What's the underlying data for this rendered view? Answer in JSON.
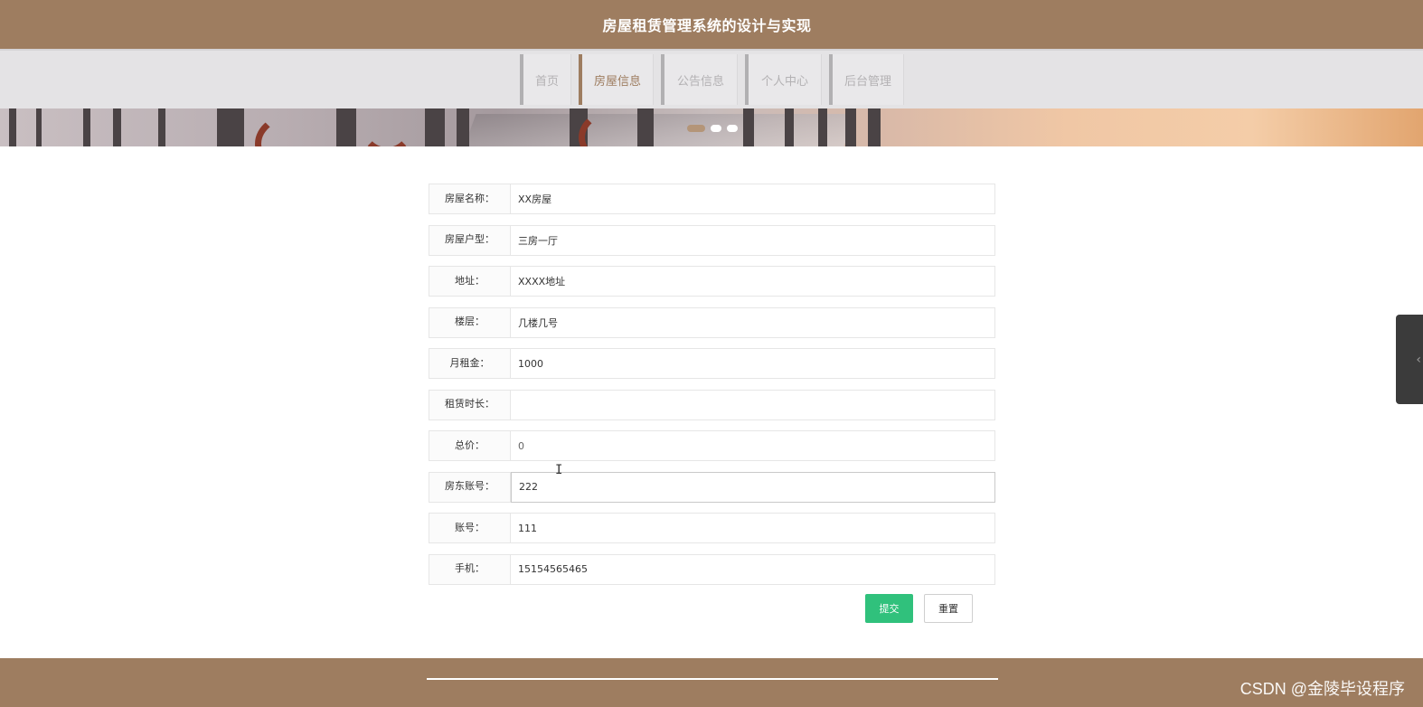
{
  "header": {
    "title": "房屋租赁管理系统的设计与实现"
  },
  "nav": {
    "items": [
      {
        "label": "首页"
      },
      {
        "label": "房屋信息"
      },
      {
        "label": "公告信息"
      },
      {
        "label": "个人中心"
      },
      {
        "label": "后台管理"
      }
    ],
    "active_index": 1
  },
  "carousel": {
    "slide_count": 3,
    "active_index": 0
  },
  "form": {
    "fields": [
      {
        "label": "房屋名称：",
        "value": "XX房屋"
      },
      {
        "label": "房屋户型：",
        "value": "三房一厅"
      },
      {
        "label": "地址：",
        "value": "XXXX地址"
      },
      {
        "label": "楼层：",
        "value": "几楼几号"
      },
      {
        "label": "月租金：",
        "value": "1000"
      },
      {
        "label": "租赁时长：",
        "value": ""
      },
      {
        "label": "总价：",
        "value": "0"
      },
      {
        "label": "房东账号：",
        "value": "222"
      },
      {
        "label": "账号：",
        "value": "111"
      },
      {
        "label": "手机：",
        "value": "15154565465"
      }
    ],
    "submit_label": "提交",
    "reset_label": "重置"
  },
  "side_tab": {
    "icon": "chevron-left-icon"
  },
  "footer": {
    "watermark": "CSDN @金陵毕设程序"
  },
  "colors": {
    "brand": "#9e7d60",
    "submit": "#30c17c",
    "nav_bg": "#e4e3e5"
  }
}
